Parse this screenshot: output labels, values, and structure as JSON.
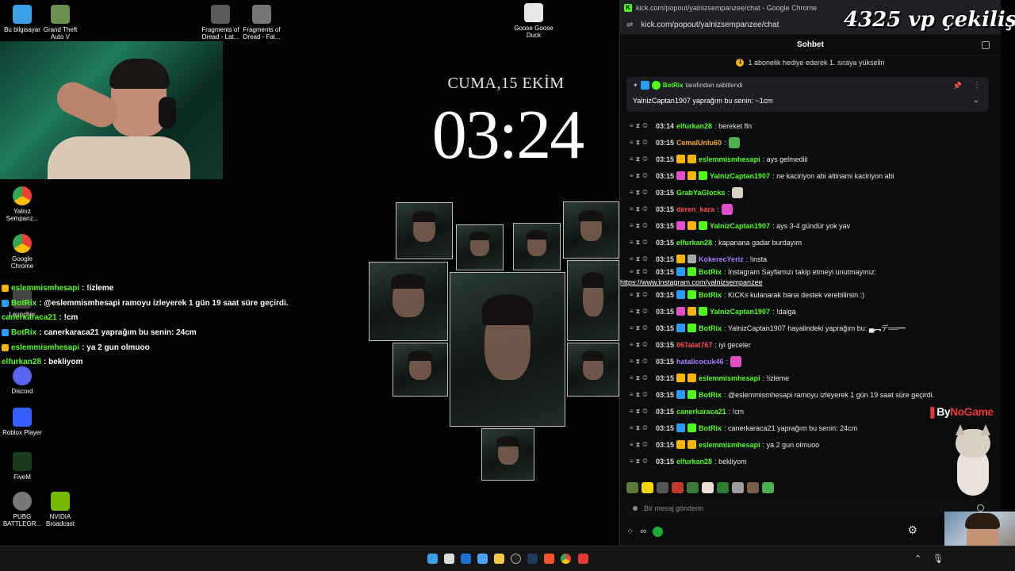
{
  "desktop": {
    "icons": [
      {
        "label": "Bu bilgisayar",
        "color": "#3aa0e8"
      },
      {
        "label": "Grand Theft Auto V",
        "color": "#6b8f4e"
      },
      {
        "label": "Fragments of Dread - Lat...",
        "color": "#5a5a5a"
      },
      {
        "label": "Fragments of Dread - Fal...",
        "color": "#777777"
      },
      {
        "label": "Goose Goose Duck",
        "color": "#e8e8e8"
      },
      {
        "label": "Yalnız Sempanz...",
        "color": "#4285f4"
      },
      {
        "label": "Google Chrome",
        "color": "#ea4335"
      },
      {
        "label": "Launcher",
        "color": "#888888"
      },
      {
        "label": "Discord",
        "color": "#5865f2"
      },
      {
        "label": "Roblox Player",
        "color": "#335fff"
      },
      {
        "label": "FiveM",
        "color": "#2e7d32"
      },
      {
        "label": "PUBG BATTLEGR...",
        "color": "#777777"
      },
      {
        "label": "NVIDIA Broadcast",
        "color": "#76b900"
      }
    ]
  },
  "overlay_chat": [
    {
      "user": "eslemmismhesapi",
      "text": " : !izleme",
      "color": "#53fc18",
      "badge": "#f7b500"
    },
    {
      "user": "BotRix",
      "text": " : @eslemmismhesapi ramoyu izleyerek 1 gün 19 saat süre geçirdi.",
      "color": "#53fc18",
      "badge": "#2a9df4"
    },
    {
      "user": "canerkaraca21",
      "text": " : !cm",
      "color": "#53fc18",
      "badge": ""
    },
    {
      "user": "BotRix",
      "text": " : canerkaraca21 yaprağım bu senin: 24cm",
      "color": "#53fc18",
      "badge": "#2a9df4"
    },
    {
      "user": "eslemmismhesapi",
      "text": " : ya 2 gun olmuoo",
      "color": "#53fc18",
      "badge": "#f7b500"
    },
    {
      "user": "elfurkan28",
      "text": " : bekliyom",
      "color": "#53fc18",
      "badge": ""
    }
  ],
  "clock": {
    "date": "CUMA,15 EKİM",
    "time": "03:24"
  },
  "chrome": {
    "window_title": "kick.com/popout/yalnizsempanzee/chat - Google Chrome",
    "favicon": "K",
    "url": "kick.com/popout/yalnizsempanzee/chat",
    "chat_title": "Sohbet",
    "gift_banner": "1 abonelik hediye ederek 1. sıraya yükselin",
    "pinned": {
      "by_user": "BotRix",
      "by_text": " tarafından sabitlendi",
      "message": "YalnizCaptan1907 yaprağım bu senin: ~1cm"
    },
    "messages": [
      {
        "time": "03:14",
        "user": "elfurkan28",
        "color": "#53fc18",
        "text": ": bereket fln",
        "badges": []
      },
      {
        "time": "03:15",
        "user": "CemalUnlu60",
        "color": "#f5a623",
        "text": ":",
        "badges": [],
        "emote": "#4caf50"
      },
      {
        "time": "03:15",
        "user": "eslemmismhesapi",
        "color": "#53fc18",
        "text": ": ays gelmediii",
        "badges": [
          "#f7b500",
          "#f7b500"
        ]
      },
      {
        "time": "03:15",
        "user": "YalnizCaptan1907",
        "color": "#53fc18",
        "text": ": ne kaciriyon abi altinami kaciriyon abi",
        "badges": [
          "#e14fc9",
          "#f7b500",
          "#53fc18"
        ]
      },
      {
        "time": "03:15",
        "user": "GrabYaGlocks",
        "color": "#53fc18",
        "text": ":",
        "badges": [],
        "emote": "#d8cfc0"
      },
      {
        "time": "03:15",
        "user": "deren_kara",
        "color": "#ff4d4d",
        "text": ":",
        "badges": [],
        "emote": "#e14fc9"
      },
      {
        "time": "03:15",
        "user": "YalnizCaptan1907",
        "color": "#53fc18",
        "text": ": ays 3-4 gündür yok yav",
        "badges": [
          "#e14fc9",
          "#f7b500",
          "#53fc18"
        ]
      },
      {
        "time": "03:15",
        "user": "elfurkan28",
        "color": "#53fc18",
        "text": ": kapanana gadar burdayım",
        "badges": []
      },
      {
        "time": "03:15",
        "user": "KokerecYeriz",
        "color": "#b07cff",
        "text": ": !insta",
        "badges": [
          "#f7b500",
          "#aaaaaa"
        ]
      },
      {
        "time": "03:15",
        "user": "BotRix",
        "color": "#53fc18",
        "text": ": İnstagram Sayfamızı takip etmeyi unutmayınız:",
        "badges": [
          "#2a9df4",
          "#53fc18"
        ],
        "link": "https://www.instagram.com/yalnizsempanzee"
      },
      {
        "time": "03:15",
        "user": "BotRix",
        "color": "#53fc18",
        "text": ": KICKs kulanarak bana destek verebilirsin :)",
        "badges": [
          "#2a9df4",
          "#53fc18"
        ]
      },
      {
        "time": "03:15",
        "user": "YalnizCaptan1907",
        "color": "#53fc18",
        "text": ": !dalga",
        "badges": [
          "#e14fc9",
          "#f7b500",
          "#53fc18"
        ]
      },
      {
        "time": "03:15",
        "user": "BotRix",
        "color": "#53fc18",
        "text": ": YalnizCaptan1907 hayalindeki yaprağım bu: ▄︻デ══━",
        "badges": [
          "#2a9df4",
          "#53fc18"
        ]
      },
      {
        "time": "03:15",
        "user": "06Talat767",
        "color": "#ff4d4d",
        "text": ": iyi geceler",
        "badges": []
      },
      {
        "time": "03:15",
        "user": "hatalicocuk46",
        "color": "#b07cff",
        "text": ":",
        "badges": [],
        "emote": "#e14fc9"
      },
      {
        "time": "03:15",
        "user": "eslemmismhesapi",
        "color": "#53fc18",
        "text": ": !izleme",
        "badges": [
          "#f7b500",
          "#f7b500"
        ]
      },
      {
        "time": "03:15",
        "user": "BotRix",
        "color": "#53fc18",
        "text": ": @eslemmismhesapi ramoyu izleyerek 1 gün 19 saat süre geçirdi.",
        "badges": [
          "#2a9df4",
          "#53fc18"
        ]
      },
      {
        "time": "03:15",
        "user": "canerkaraca21",
        "color": "#53fc18",
        "text": ": !cm",
        "badges": []
      },
      {
        "time": "03:15",
        "user": "BotRix",
        "color": "#53fc18",
        "text": ": canerkaraca21 yaprağım bu senin: 24cm",
        "badges": [
          "#2a9df4",
          "#53fc18"
        ]
      },
      {
        "time": "03:15",
        "user": "eslemmismhesapi",
        "color": "#53fc18",
        "text": ": ya 2 gun olmuoo",
        "badges": [
          "#f7b500",
          "#f7b500"
        ]
      },
      {
        "time": "03:15",
        "user": "elfurkan28",
        "color": "#53fc18",
        "text": ": bekliyom",
        "badges": []
      }
    ],
    "message_placeholder": "Bir mesaj gönderin",
    "footer_icon": "∞"
  },
  "overlays": {
    "giveaway": "4325 vp çekiliş",
    "sponsor_prefix": "By",
    "sponsor_name": "NoGame"
  },
  "accent": "#53fc18"
}
